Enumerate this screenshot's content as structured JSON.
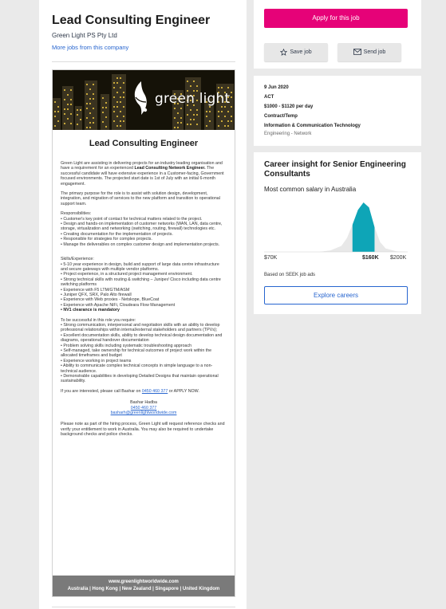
{
  "job": {
    "title": "Lead Consulting Engineer",
    "company": "Green Light PS Pty Ltd",
    "more_jobs": "More jobs from this company"
  },
  "ad": {
    "logo_text": "green light",
    "title": "Lead Consulting Engineer",
    "intro_a": "Green Light are assisting in delivering projects for an industry leading organisation and have a requirement for an experienced ",
    "intro_b": "Lead Consulting Network Engineer.",
    "intro_c": " The successful candidate will have extensive experience in a Customer-facing, Government focused environments. The projected start date is 1st of July with an initial 6-month engagement.",
    "purpose": "The primary purpose for the role is to assist with solution design, development, integration, and migration of services to the new platform and transition to operational support team.",
    "resp_heading": "Responsibilities:",
    "responsibilities": [
      "•   Customer's key point of contact for technical matters related to the project.",
      "•   Design and hands-on implementation of customer networks (WAN, LAN, data centre, storage, virtualization and networking (switching, routing, firewall) technologies etc.",
      "•   Creating documentation for the implementation of projects.",
      "•   Responsible for strategies for complex projects.",
      "•   Manage the deliverables on complex customer design and implementation projects."
    ],
    "skills_heading": "Skills/Experience:",
    "skills": [
      "•   5-10 year experience in design, build and support of large data centre infrastructure and secure gateways with multiple vendor platforms.",
      "•   Project experience, in a structured project management environment.",
      "•   Strong technical skills with routing & switching – Juniper/ Cisco including data centre switching platforms",
      "•   Experience with F5 LTM/GTM/ASM",
      "•   Juniper QFX, SRX, Palo Alto firewall",
      "•   Experience with Web proxies - Netskope, BlueCoat",
      "•   Experience with Apache NiFi, Cloudeara Flow Management"
    ],
    "skills_bold": "•   NV1 clearance is mandatory",
    "success_heading": "To be successful in this role you require:",
    "success": [
      "•   Strong communication, interpersonal and negotiation skills with an ability to develop professional relationships within internal/external stakeholders and partners (TPVs);",
      "•   Excellent documentation skills, ability to develop technical design documentation and diagrams, operational handover documentation",
      "•   Problem solving skills including systematic troubleshooting approach",
      "•   Self-managed, take ownership for technical outcomes of project work within the allocated timeframes and budget",
      "•   Experience working in project teams",
      "•   Ability to communicate complex technical concepts in simple language to a non-technical audience.",
      "•   Demonstrable capabilities in developing Detailed Designs that maintain operational sustainability."
    ],
    "apply_a": "If you are interested, please call Bashar on ",
    "apply_phone": "0450 460 377",
    "apply_b": " or APPLY NOW.",
    "contact_name": "Bashar Hadba",
    "contact_phone": "0450 460 377",
    "contact_email": "basharh@greenlightworldwide.com",
    "note": "Please note as part of the hiring process, Green Light will request reference checks and verify your entitlement to work in Australia. You may also be required to undertake background checks and police checks.",
    "footer_url": "www.greenlightworldwide.com",
    "footer_locations": "Australia | Hong Kong | New Zealand | Singapore | United Kingdom"
  },
  "actions": {
    "apply": "Apply for this job",
    "save": "Save job",
    "send": "Send job"
  },
  "details": {
    "date": "9 Jun 2020",
    "location": "ACT",
    "salary": "$1000 - $1120 per day",
    "work_type": "Contract/Temp",
    "classification": "Information & Communication Technology",
    "sub_classification": "Engineering - Network"
  },
  "insight": {
    "title": "Career insight for Senior Engineering Consultants",
    "subtitle": "Most common salary in Australia",
    "based_on": "Based on SEEK job ads",
    "explore": "Explore careers"
  },
  "colors": {
    "apply": "#e60278",
    "link": "#2765cf",
    "chart_fill": "#e8e8e8",
    "chart_highlight": "#0ea5b7"
  },
  "chart_data": {
    "type": "area",
    "x_ticks": [
      "$70K",
      "$160K",
      "$200K"
    ],
    "xlim": [
      70,
      200
    ],
    "highlight_tick": "$160K",
    "highlight_range": [
      150,
      170
    ],
    "x": [
      70,
      80,
      90,
      100,
      110,
      120,
      130,
      140,
      145,
      150,
      155,
      160,
      165,
      170,
      175,
      180,
      190,
      200
    ],
    "y": [
      0,
      0,
      0,
      0,
      0,
      0,
      0.03,
      0.12,
      0.28,
      0.55,
      0.85,
      1.0,
      0.9,
      0.5,
      0.2,
      0.07,
      0.01,
      0
    ]
  }
}
